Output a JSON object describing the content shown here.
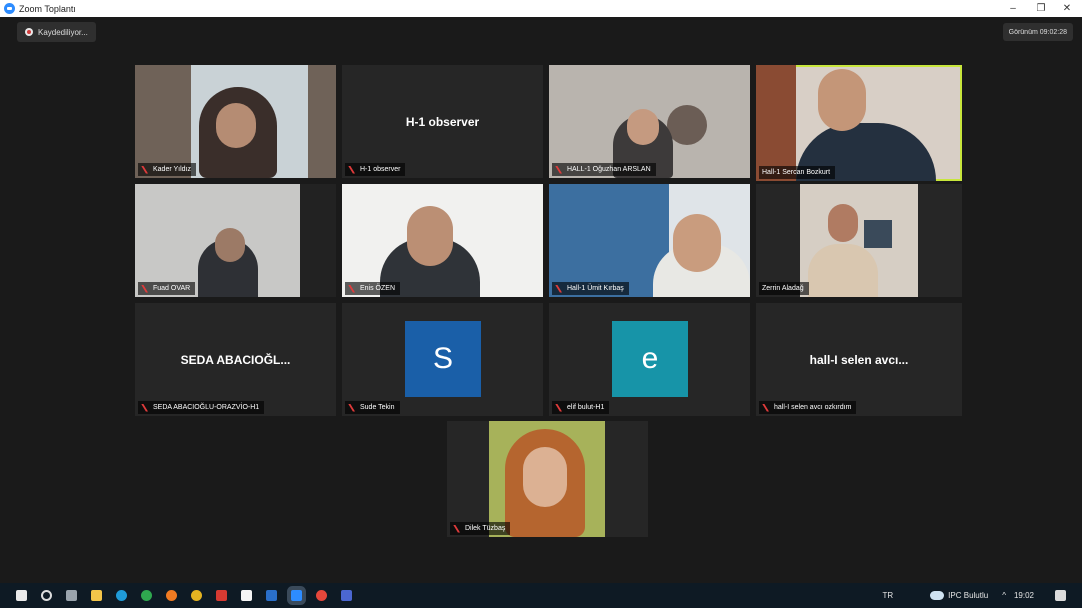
{
  "window": {
    "title": "Zoom Toplantı",
    "controls": [
      "–",
      "❐",
      "✕"
    ]
  },
  "recording": {
    "label": "Kaydediliyor..."
  },
  "view_button": {
    "label": "Görünüm 09:02:28"
  },
  "participants": [
    {
      "name": "Kader Yıldız",
      "type": "video"
    },
    {
      "name": "H-1 observer",
      "display_text": "H-1 observer",
      "type": "name"
    },
    {
      "name": "HALL-1 Oğuzhan ARSLAN",
      "type": "video"
    },
    {
      "name": "Hall-1 Sercan Bozkurt",
      "type": "video",
      "active_speaker": true
    },
    {
      "name": "Fuad OVAR",
      "type": "video"
    },
    {
      "name": "Enis ÖZEN",
      "type": "video"
    },
    {
      "name": "Hall-1 Ümit Kırbaş",
      "type": "video"
    },
    {
      "name": "Zerrin Aladağ",
      "type": "video"
    },
    {
      "name": "SEDA ABACIOĞLU-ORAZVİO-H1",
      "display_text": "SEDA ABACIOĞL...",
      "type": "name"
    },
    {
      "name": "Sude Tekin",
      "avatar_letter": "S",
      "avatar_color": "#1a5fa8",
      "type": "avatar"
    },
    {
      "name": "elif bulut-H1",
      "avatar_letter": "e",
      "avatar_color": "#1794a8",
      "type": "avatar"
    },
    {
      "name": "hall-I selen avcı ozkırdım",
      "display_text": "hall-I selen avcı...",
      "type": "name"
    },
    {
      "name": "Dilek Tüzbaş",
      "type": "video"
    }
  ],
  "taskbar": {
    "weather": "IPC Bulutlu",
    "language": "TR",
    "clock": "19:02",
    "icons": [
      "start-icon",
      "search-icon",
      "task-view-icon",
      "file-explorer-icon",
      "edge-icon",
      "chrome-icon",
      "firefox-icon",
      "chrome-icon",
      "acrobat-icon",
      "notes-icon",
      "outlook-icon",
      "zoom-icon",
      "chrome-icon",
      "teams-icon"
    ]
  },
  "colors": {
    "active_outline": "#c8e63c",
    "muted_mic": "#e03b3b",
    "tile_bg": "#262626",
    "taskbar_bg": "#0e1a24"
  }
}
